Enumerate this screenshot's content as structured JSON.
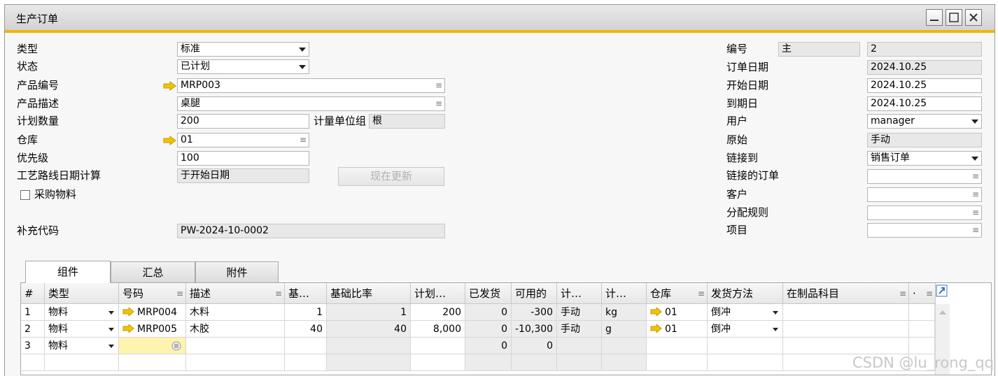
{
  "window": {
    "title": "生产订单"
  },
  "header_left": {
    "type": {
      "label": "类型",
      "value": "标准"
    },
    "status": {
      "label": "状态",
      "value": "已计划"
    },
    "product_no": {
      "label": "产品编号",
      "value": "MRP003"
    },
    "product_desc": {
      "label": "产品描述",
      "value": "桌腿"
    },
    "planned_qty": {
      "label": "计划数量",
      "value": "200"
    },
    "uom": {
      "label": "计量单位组",
      "value": "根"
    },
    "warehouse": {
      "label": "仓库",
      "value": "01"
    },
    "priority": {
      "label": "优先级",
      "value": "100"
    },
    "routing_date": {
      "label": "工艺路线日期计算",
      "value": "于开始日期"
    },
    "update_button": "现在更新",
    "purchase_checkbox": "采购物料",
    "replenish": {
      "label": "补充代码",
      "value": "PW-2024-10-0002"
    }
  },
  "header_right": {
    "number": {
      "label": "编号",
      "series": "主",
      "value": "2"
    },
    "order_date": {
      "label": "订单日期",
      "value": "2024.10.25"
    },
    "start_date": {
      "label": "开始日期",
      "value": "2024.10.25"
    },
    "due_date": {
      "label": "到期日",
      "value": "2024.10.25"
    },
    "user": {
      "label": "用户",
      "value": "manager"
    },
    "origin": {
      "label": "原始",
      "value": "手动"
    },
    "linked_to": {
      "label": "链接到",
      "value": "销售订单"
    },
    "linked_order": {
      "label": "链接的订单",
      "value": ""
    },
    "customer": {
      "label": "客户",
      "value": ""
    },
    "distribution_rule": {
      "label": "分配规则",
      "value": ""
    },
    "project": {
      "label": "项目",
      "value": ""
    }
  },
  "tabs": [
    "组件",
    "汇总",
    "附件"
  ],
  "grid": {
    "headers": [
      "#",
      "类型",
      "号码",
      "描述",
      "基…",
      "基础比率",
      "计划…",
      "已发货",
      "可用的",
      "计…",
      "计…",
      "仓库",
      "发货方法",
      "在制品科目",
      "·"
    ],
    "rows": [
      [
        "1",
        "物料",
        "MRP004",
        "木料",
        "1",
        "1",
        "200",
        "0",
        "-300",
        "手动",
        "kg",
        "01",
        "倒冲",
        ""
      ],
      [
        "2",
        "物料",
        "MRP005",
        "木胶",
        "40",
        "40",
        "8,000",
        "0",
        "-10,300",
        "手动",
        "g",
        "01",
        "倒冲",
        ""
      ],
      [
        "3",
        "物料",
        "",
        "",
        "",
        "",
        "",
        "0",
        "0",
        "",
        "",
        "",
        "",
        ""
      ]
    ]
  },
  "watermark": "CSDN @lu_rong_qq",
  "colors": {
    "accent": "#f4b400",
    "arrow": "#f2c200"
  }
}
